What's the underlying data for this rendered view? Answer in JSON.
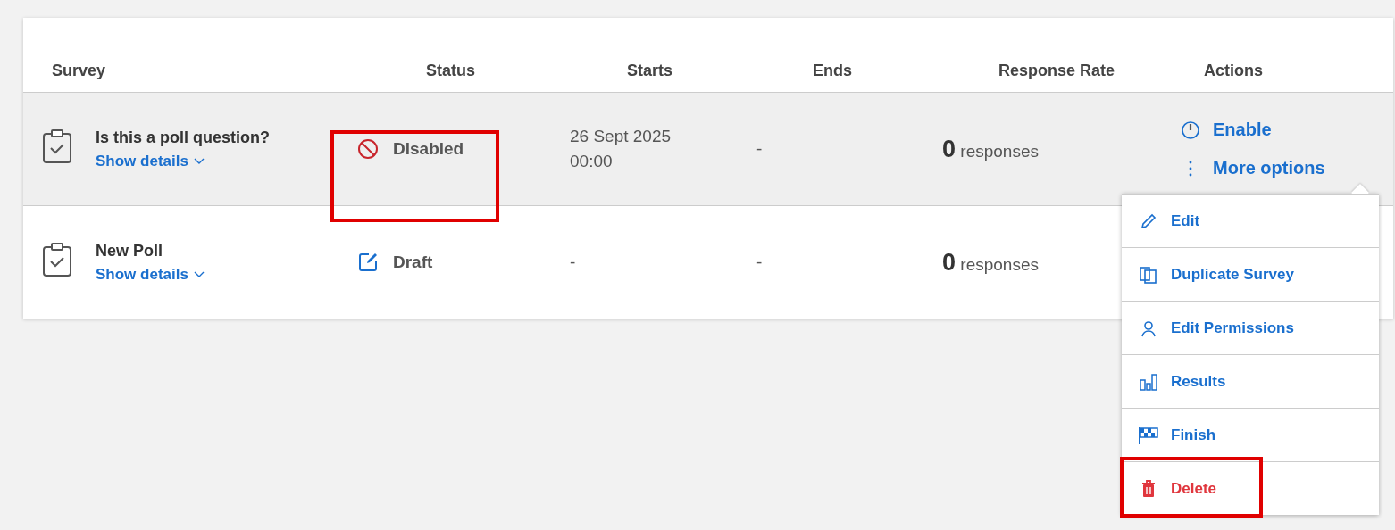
{
  "table": {
    "columns": [
      "Survey",
      "Status",
      "Starts",
      "Ends",
      "Response Rate",
      "Actions"
    ],
    "rows": [
      {
        "title": "Is this a poll question?",
        "details_link": "Show details",
        "selected": true,
        "status": {
          "kind": "disabled",
          "label": "Disabled",
          "highlighted": true
        },
        "starts": "26 Sept 2025 00:00",
        "ends": "-",
        "responses": {
          "count": "0",
          "label": "responses"
        },
        "actions": [
          {
            "kind": "power",
            "label": "Enable"
          },
          {
            "kind": "more",
            "label": "More options"
          }
        ]
      },
      {
        "title": "New Poll",
        "details_link": "Show details",
        "selected": false,
        "status": {
          "kind": "draft",
          "label": "Draft",
          "highlighted": false
        },
        "starts": "-",
        "ends": "-",
        "responses": {
          "count": "0",
          "label": "responses"
        },
        "actions": []
      }
    ]
  },
  "menu": {
    "items": [
      {
        "kind": "edit",
        "label": "Edit",
        "highlighted": false
      },
      {
        "kind": "duplicate",
        "label": "Duplicate Survey",
        "highlighted": false
      },
      {
        "kind": "permissions",
        "label": "Edit Permissions",
        "highlighted": false
      },
      {
        "kind": "results",
        "label": "Results",
        "highlighted": false
      },
      {
        "kind": "finish",
        "label": "Finish",
        "highlighted": false
      },
      {
        "kind": "delete",
        "label": "Delete",
        "highlighted": true
      }
    ]
  }
}
